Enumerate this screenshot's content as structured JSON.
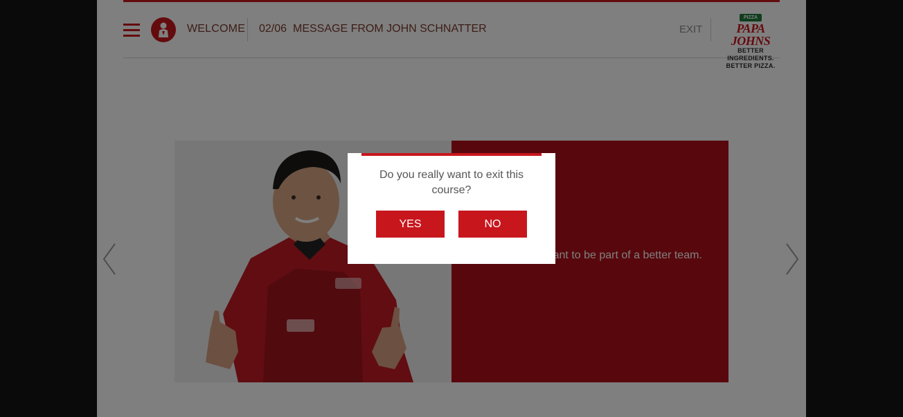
{
  "header": {
    "welcome": "WELCOME",
    "page_number": "02/06",
    "page_title": "MESSAGE FROM JOHN SCHNATTER",
    "exit_label": "EXIT",
    "logo": {
      "badge": "PIZZA",
      "name": "PAPA JOHNS",
      "tagline_1": "BETTER INGREDIENTS.",
      "tagline_2": "BETTER PIZZA."
    }
  },
  "slide": {
    "panel_text": "...ud that you want to be part of a better team."
  },
  "dialog": {
    "message": "Do you really want to exit this course?",
    "yes_label": "YES",
    "no_label": "NO"
  },
  "icons": {
    "menu": "hamburger-menu-icon",
    "mascot": "mascot-icon",
    "prev": "chevron-left-icon",
    "next": "chevron-right-icon"
  },
  "colors": {
    "brand_red": "#c8161d",
    "brand_green": "#1f7a3b",
    "header_text": "#7a3a2c"
  }
}
